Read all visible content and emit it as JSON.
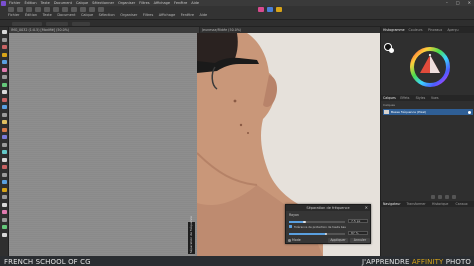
{
  "app": {
    "menu": [
      "Fichier",
      "Édition",
      "Texte",
      "Document",
      "Calque",
      "Sélectionner",
      "Organiser",
      "Filtres",
      "Affichage",
      "Fenêtre",
      "Aide"
    ],
    "window_controls": [
      "–",
      "□",
      "✕"
    ]
  },
  "toolbar": {
    "labels": [
      "Fichier",
      "Édition",
      "Texte",
      "Document",
      "Calque",
      "Sélection",
      "Organiser",
      "Filtres",
      "Affichage",
      "Fenêtre",
      "Aide"
    ]
  },
  "document": {
    "tabs": [
      "IMG_0032 (1:0.5) [Modifié] (50.0%)",
      "Jeunesse/Ridée (50.0%)"
    ]
  },
  "canvas": {
    "vertical_hint": "Séparation de fréquence"
  },
  "dialog": {
    "title": "Séparation de fréquence",
    "close": "✕",
    "radius_label": "Rayon",
    "radius_value": "7.5 px",
    "checkbox_label": "Tolérance de protection de hauts bas",
    "protect_value": "87 %",
    "mode_label": "Mode",
    "btn_apply": "Appliquer",
    "btn_cancel": "Annuler",
    "radius_slider": 0.28,
    "protect_slider": 0.66
  },
  "right_panel": {
    "tabs_top": [
      "Histogramme",
      "Couleurs",
      "Pinceaux",
      "Aperçu"
    ],
    "tabs_layers": [
      "Calques",
      "Effets",
      "Styles",
      "Vues"
    ],
    "layers_header": "Calques",
    "opacity_label": "Opacité",
    "layer_name": "Basse fréquence (Pixel)",
    "tabs_bottom": [
      "Navigateur",
      "Transformer",
      "Historique",
      "Canaux"
    ]
  },
  "footer": {
    "brand_left": "FRENCH SCHOOL OF CG",
    "brand_right_a": "J'APPRENDRE",
    "brand_right_b": "AFFINITY",
    "brand_right_c": "PHOTO",
    "accent_color": "#d8a418"
  },
  "icons": [
    "affinity-logo-icon",
    "color-wheel-icon",
    "close-icon"
  ]
}
